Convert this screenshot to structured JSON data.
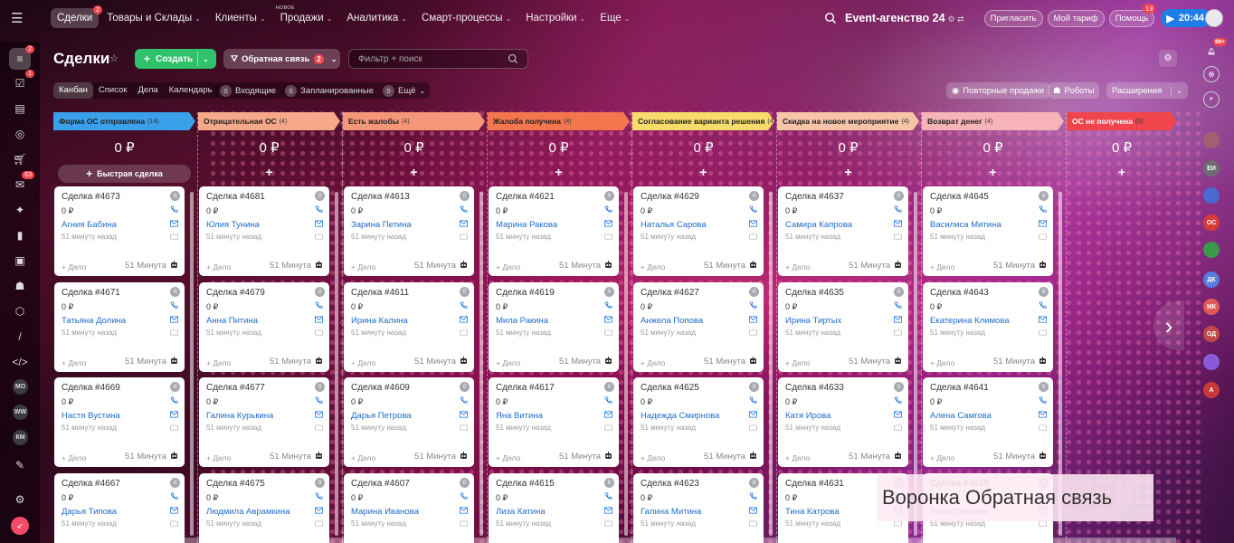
{
  "topbar": {
    "nav": [
      {
        "label": "Сделки",
        "badge": "2",
        "active": true
      },
      {
        "label": "Товары и Склады"
      },
      {
        "label": "Клиенты"
      },
      {
        "label": "Продажи",
        "tag": "НОВОЕ"
      },
      {
        "label": "Аналитика"
      },
      {
        "label": "Смарт-процессы"
      },
      {
        "label": "Настройки"
      },
      {
        "label": "Еще"
      }
    ],
    "company": "Event-агенство 24",
    "invite": "Пригласить",
    "tariff": "Мой тариф",
    "help": "Помощь",
    "help_badge": "13",
    "time": "20:44"
  },
  "left_sidebar": {
    "crm_badge": "2",
    "tasks_badge": "1",
    "chat_badge": "63",
    "avatars": [
      "МО",
      "WW",
      "КМ"
    ]
  },
  "right_sidebar": {
    "bell_badge": "99+",
    "avatars": [
      {
        "label": "ЕИ",
        "color": "#6d6d72"
      },
      {
        "label": "",
        "color": "#4a6ad0"
      },
      {
        "label": "ОС",
        "color": "#d83a3a"
      },
      {
        "label": "",
        "color": "#3a9a4a"
      },
      {
        "label": "ДК",
        "color": "#5a7ae0"
      },
      {
        "label": "МК",
        "color": "#e05a5a"
      },
      {
        "label": "ОД",
        "color": "#c04a4a"
      },
      {
        "label": "",
        "color": "#8a5ad8"
      },
      {
        "label": "А",
        "color": "#c83a3a"
      }
    ]
  },
  "page": {
    "title": "Сделки",
    "create": "Создать",
    "funnel": "Обратная связь",
    "funnel_badge": "2",
    "filter_placeholder": "Фильтр + поиск"
  },
  "views": [
    "Канбан",
    "Список",
    "Дела",
    "Календарь"
  ],
  "counters": [
    {
      "n": "0",
      "label": "Входящие"
    },
    {
      "n": "0",
      "label": "Запланированные"
    },
    {
      "n": "0",
      "label": "Ещё"
    }
  ],
  "right_buttons": {
    "repeat": "Повторные продажи",
    "robots": "Роботы",
    "ext": "Расширения"
  },
  "quick_deal": "Быстрая сделка",
  "card_common": {
    "sum": "0 ₽",
    "ago": "51 минуту назад",
    "add": "+ Дело",
    "time": "51 Минута",
    "zero": "0"
  },
  "stages": [
    {
      "name": "Форма ОС отправлена",
      "count": "(14)",
      "color": "#3aa0ea",
      "sum": "0 ₽",
      "cards": [
        {
          "title": "Сделка #4673",
          "client": "Агния Бабина"
        },
        {
          "title": "Сделка #4671",
          "client": "Татьяна Долина"
        },
        {
          "title": "Сделка #4669",
          "client": "Настя Вустина"
        },
        {
          "title": "Сделка #4667",
          "client": "Дарья Типова"
        }
      ]
    },
    {
      "name": "Отрицательная ОС",
      "count": "(4)",
      "color": "#f5a98a",
      "sum": "0 ₽",
      "cards": [
        {
          "title": "Сделка #4681",
          "client": "Юлия Тунина"
        },
        {
          "title": "Сделка #4679",
          "client": "Анна Питина"
        },
        {
          "title": "Сделка #4677",
          "client": "Галина Курькина"
        },
        {
          "title": "Сделка #4675",
          "client": "Людмила Аврамкина"
        }
      ]
    },
    {
      "name": "Есть жалобы",
      "count": "(4)",
      "color": "#f59678",
      "sum": "0 ₽",
      "cards": [
        {
          "title": "Сделка #4613",
          "client": "Зарина Петина"
        },
        {
          "title": "Сделка #4611",
          "client": "Ирина Калина"
        },
        {
          "title": "Сделка #4609",
          "client": "Дарья Петрова"
        },
        {
          "title": "Сделка #4607",
          "client": "Марина Иванова"
        }
      ]
    },
    {
      "name": "Жалоба получена",
      "count": "(4)",
      "color": "#f4764e",
      "sum": "0 ₽",
      "cards": [
        {
          "title": "Сделка #4621",
          "client": "Марина Ракова"
        },
        {
          "title": "Сделка #4619",
          "client": "Мила Ракина"
        },
        {
          "title": "Сделка #4617",
          "client": "Яна Витина"
        },
        {
          "title": "Сделка #4615",
          "client": "Лиза Катина"
        }
      ]
    },
    {
      "name": "Согласование варианта решения",
      "count": "(4)",
      "color": "#f7dc6c",
      "sum": "0 ₽",
      "cards": [
        {
          "title": "Сделка #4629",
          "client": "Наталья Сарова"
        },
        {
          "title": "Сделка #4627",
          "client": "Анжела Попова"
        },
        {
          "title": "Сделка #4625",
          "client": "Надежда Смирнова"
        },
        {
          "title": "Сделка #4623",
          "client": "Галина Митина"
        }
      ]
    },
    {
      "name": "Скидка на новое мероприятие",
      "count": "(4)",
      "color": "#f7c4a8",
      "sum": "0 ₽",
      "cards": [
        {
          "title": "Сделка #4637",
          "client": "Самира Капрова"
        },
        {
          "title": "Сделка #4635",
          "client": "Ирина Тиртых"
        },
        {
          "title": "Сделка #4633",
          "client": "Катя Ирова"
        },
        {
          "title": "Сделка #4631",
          "client": "Тина Катрова"
        }
      ]
    },
    {
      "name": "Возврат денег",
      "count": "(4)",
      "color": "#f7b4b8",
      "sum": "0 ₽",
      "cards": [
        {
          "title": "Сделка #4645",
          "client": "Василиса Митина"
        },
        {
          "title": "Сделка #4643",
          "client": "Екатерина Климова"
        },
        {
          "title": "Сделка #4641",
          "client": "Алена Самгова"
        },
        {
          "title": "Сделка #4639",
          "client": "Анна Павлова"
        }
      ]
    },
    {
      "name": "ОС не получена",
      "count": "(0)",
      "color": "#f0454c",
      "sum": "0 ₽",
      "cards": []
    }
  ],
  "overlay_caption": "Воронка Обратная связь"
}
